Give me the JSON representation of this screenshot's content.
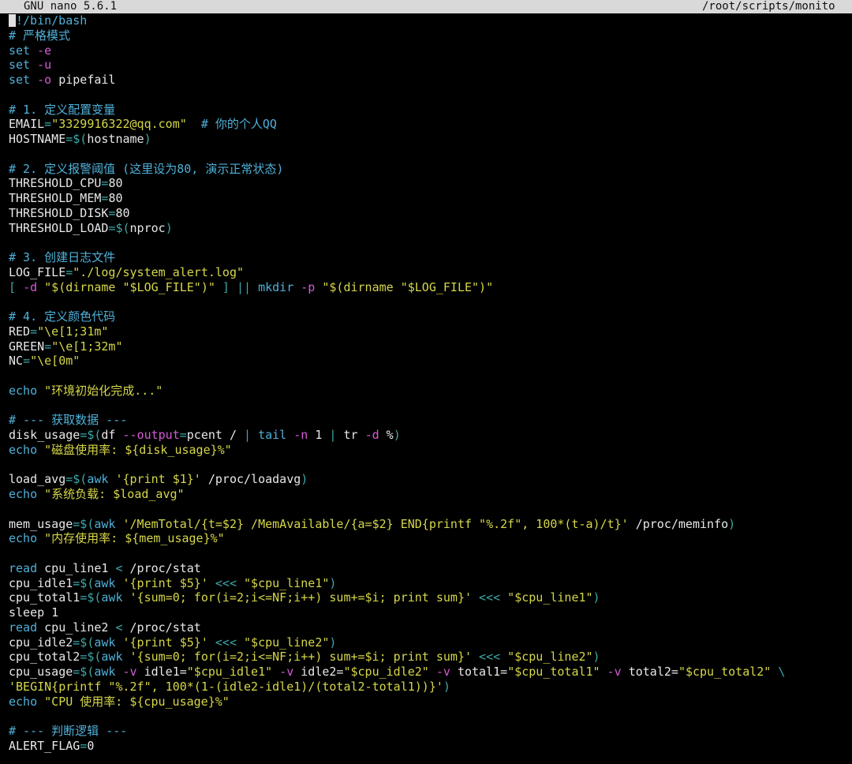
{
  "titlebar": {
    "app": "GNU nano 5.6.1",
    "path": "/root/scripts/monito"
  },
  "colors": {
    "background": "#000000",
    "default_text": "#e8e8e8",
    "comment": "#4fb0d8",
    "keyword": "#4fb0d8",
    "string": "#d6d64a",
    "operator": "#3fa8a8",
    "option": "#d65ad6",
    "titlebar_bg": "#d9d9d9"
  },
  "lines": [
    [
      {
        "t": "#!/bin/bash",
        "c": "comment",
        "cursor": true
      }
    ],
    [
      {
        "t": "# 严格模式",
        "c": "comment"
      }
    ],
    [
      {
        "t": "set",
        "c": "keyword"
      },
      {
        "t": " "
      },
      {
        "t": "-e",
        "c": "option"
      }
    ],
    [
      {
        "t": "set",
        "c": "keyword"
      },
      {
        "t": " "
      },
      {
        "t": "-u",
        "c": "option"
      }
    ],
    [
      {
        "t": "set",
        "c": "keyword"
      },
      {
        "t": " "
      },
      {
        "t": "-o",
        "c": "option"
      },
      {
        "t": " pipefail"
      }
    ],
    [],
    [
      {
        "t": "# 1. 定义配置变量",
        "c": "comment"
      }
    ],
    [
      {
        "t": "EMAIL"
      },
      {
        "t": "=",
        "c": "operator"
      },
      {
        "t": "\"3329916322@qq.com\"",
        "c": "string"
      },
      {
        "t": "  "
      },
      {
        "t": "# 你的个人QQ",
        "c": "comment"
      }
    ],
    [
      {
        "t": "HOSTNAME"
      },
      {
        "t": "=$(",
        "c": "operator"
      },
      {
        "t": "hostname"
      },
      {
        "t": ")",
        "c": "operator"
      }
    ],
    [],
    [
      {
        "t": "# 2. 定义报警阈值 (这里设为80, 演示正常状态)",
        "c": "comment"
      }
    ],
    [
      {
        "t": "THRESHOLD_CPU"
      },
      {
        "t": "=",
        "c": "operator"
      },
      {
        "t": "80"
      }
    ],
    [
      {
        "t": "THRESHOLD_MEM"
      },
      {
        "t": "=",
        "c": "operator"
      },
      {
        "t": "80"
      }
    ],
    [
      {
        "t": "THRESHOLD_DISK"
      },
      {
        "t": "=",
        "c": "operator"
      },
      {
        "t": "80"
      }
    ],
    [
      {
        "t": "THRESHOLD_LOAD"
      },
      {
        "t": "=$(",
        "c": "operator"
      },
      {
        "t": "nproc"
      },
      {
        "t": ")",
        "c": "operator"
      }
    ],
    [],
    [
      {
        "t": "# 3. 创建日志文件",
        "c": "comment"
      }
    ],
    [
      {
        "t": "LOG_FILE"
      },
      {
        "t": "=",
        "c": "operator"
      },
      {
        "t": "\"./log/system_alert.log\"",
        "c": "string"
      }
    ],
    [
      {
        "t": "[ ",
        "c": "operator"
      },
      {
        "t": "-d",
        "c": "option"
      },
      {
        "t": " "
      },
      {
        "t": "\"$(dirname \"$LOG_FILE\")\"",
        "c": "string"
      },
      {
        "t": " ] || ",
        "c": "operator"
      },
      {
        "t": "mkdir",
        "c": "keyword"
      },
      {
        "t": " "
      },
      {
        "t": "-p",
        "c": "option"
      },
      {
        "t": " "
      },
      {
        "t": "\"$(dirname \"$LOG_FILE\")\"",
        "c": "string"
      }
    ],
    [],
    [
      {
        "t": "# 4. 定义颜色代码",
        "c": "comment"
      }
    ],
    [
      {
        "t": "RED"
      },
      {
        "t": "=",
        "c": "operator"
      },
      {
        "t": "\"\\e[1;31m\"",
        "c": "string"
      }
    ],
    [
      {
        "t": "GREEN"
      },
      {
        "t": "=",
        "c": "operator"
      },
      {
        "t": "\"\\e[1;32m\"",
        "c": "string"
      }
    ],
    [
      {
        "t": "NC"
      },
      {
        "t": "=",
        "c": "operator"
      },
      {
        "t": "\"\\e[0m\"",
        "c": "string"
      }
    ],
    [],
    [
      {
        "t": "echo",
        "c": "keyword"
      },
      {
        "t": " "
      },
      {
        "t": "\"环境初始化完成...\"",
        "c": "string"
      }
    ],
    [],
    [
      {
        "t": "# --- 获取数据 ---",
        "c": "comment"
      }
    ],
    [
      {
        "t": "disk_usage"
      },
      {
        "t": "=$(",
        "c": "operator"
      },
      {
        "t": "df "
      },
      {
        "t": "--output",
        "c": "option"
      },
      {
        "t": "=",
        "c": "operator"
      },
      {
        "t": "pcent / "
      },
      {
        "t": "| ",
        "c": "operator"
      },
      {
        "t": "tail",
        "c": "keyword"
      },
      {
        "t": " "
      },
      {
        "t": "-n",
        "c": "option"
      },
      {
        "t": " 1 "
      },
      {
        "t": "| ",
        "c": "operator"
      },
      {
        "t": "tr "
      },
      {
        "t": "-d",
        "c": "option"
      },
      {
        "t": " %"
      },
      {
        "t": ")",
        "c": "operator"
      }
    ],
    [
      {
        "t": "echo",
        "c": "keyword"
      },
      {
        "t": " "
      },
      {
        "t": "\"磁盘使用率: ${disk_usage}%\"",
        "c": "string"
      }
    ],
    [],
    [
      {
        "t": "load_avg"
      },
      {
        "t": "=$(",
        "c": "operator"
      },
      {
        "t": "awk",
        "c": "keyword"
      },
      {
        "t": " "
      },
      {
        "t": "'{print $1}'",
        "c": "string"
      },
      {
        "t": " /proc/loadavg"
      },
      {
        "t": ")",
        "c": "operator"
      }
    ],
    [
      {
        "t": "echo",
        "c": "keyword"
      },
      {
        "t": " "
      },
      {
        "t": "\"系统负载: $load_avg\"",
        "c": "string"
      }
    ],
    [],
    [
      {
        "t": "mem_usage"
      },
      {
        "t": "=$(",
        "c": "operator"
      },
      {
        "t": "awk",
        "c": "keyword"
      },
      {
        "t": " "
      },
      {
        "t": "'/MemTotal/{t=$2} /MemAvailable/{a=$2} END{printf \"%.2f\", 100*(t-a)/t}'",
        "c": "string"
      },
      {
        "t": " /proc/meminfo"
      },
      {
        "t": ")",
        "c": "operator"
      }
    ],
    [
      {
        "t": "echo",
        "c": "keyword"
      },
      {
        "t": " "
      },
      {
        "t": "\"内存使用率: ${mem_usage}%\"",
        "c": "string"
      }
    ],
    [],
    [
      {
        "t": "read",
        "c": "keyword"
      },
      {
        "t": " cpu_line1 "
      },
      {
        "t": "<",
        "c": "operator"
      },
      {
        "t": " /proc/stat"
      }
    ],
    [
      {
        "t": "cpu_idle1"
      },
      {
        "t": "=$(",
        "c": "operator"
      },
      {
        "t": "awk",
        "c": "keyword"
      },
      {
        "t": " "
      },
      {
        "t": "'{print $5}'",
        "c": "string"
      },
      {
        "t": " "
      },
      {
        "t": "<<<",
        "c": "operator"
      },
      {
        "t": " "
      },
      {
        "t": "\"$cpu_line1\"",
        "c": "string"
      },
      {
        "t": ")",
        "c": "operator"
      }
    ],
    [
      {
        "t": "cpu_total1"
      },
      {
        "t": "=$(",
        "c": "operator"
      },
      {
        "t": "awk",
        "c": "keyword"
      },
      {
        "t": " "
      },
      {
        "t": "'{sum=0; for(i=2;i<=NF;i++) sum+=$i; print sum}'",
        "c": "string"
      },
      {
        "t": " "
      },
      {
        "t": "<<<",
        "c": "operator"
      },
      {
        "t": " "
      },
      {
        "t": "\"$cpu_line1\"",
        "c": "string"
      },
      {
        "t": ")",
        "c": "operator"
      }
    ],
    [
      {
        "t": "sleep 1"
      }
    ],
    [
      {
        "t": "read",
        "c": "keyword"
      },
      {
        "t": " cpu_line2 "
      },
      {
        "t": "<",
        "c": "operator"
      },
      {
        "t": " /proc/stat"
      }
    ],
    [
      {
        "t": "cpu_idle2"
      },
      {
        "t": "=$(",
        "c": "operator"
      },
      {
        "t": "awk",
        "c": "keyword"
      },
      {
        "t": " "
      },
      {
        "t": "'{print $5}'",
        "c": "string"
      },
      {
        "t": " "
      },
      {
        "t": "<<<",
        "c": "operator"
      },
      {
        "t": " "
      },
      {
        "t": "\"$cpu_line2\"",
        "c": "string"
      },
      {
        "t": ")",
        "c": "operator"
      }
    ],
    [
      {
        "t": "cpu_total2"
      },
      {
        "t": "=$(",
        "c": "operator"
      },
      {
        "t": "awk",
        "c": "keyword"
      },
      {
        "t": " "
      },
      {
        "t": "'{sum=0; for(i=2;i<=NF;i++) sum+=$i; print sum}'",
        "c": "string"
      },
      {
        "t": " "
      },
      {
        "t": "<<<",
        "c": "operator"
      },
      {
        "t": " "
      },
      {
        "t": "\"$cpu_line2\"",
        "c": "string"
      },
      {
        "t": ")",
        "c": "operator"
      }
    ],
    [
      {
        "t": "cpu_usage"
      },
      {
        "t": "=$(",
        "c": "operator"
      },
      {
        "t": "awk",
        "c": "keyword"
      },
      {
        "t": " "
      },
      {
        "t": "-v",
        "c": "option"
      },
      {
        "t": " idle1="
      },
      {
        "t": "\"$cpu_idle1\"",
        "c": "string"
      },
      {
        "t": " "
      },
      {
        "t": "-v",
        "c": "option"
      },
      {
        "t": " idle2="
      },
      {
        "t": "\"$cpu_idle2\"",
        "c": "string"
      },
      {
        "t": " "
      },
      {
        "t": "-v",
        "c": "option"
      },
      {
        "t": " total1="
      },
      {
        "t": "\"$cpu_total1\"",
        "c": "string"
      },
      {
        "t": " "
      },
      {
        "t": "-v",
        "c": "option"
      },
      {
        "t": " total2="
      },
      {
        "t": "\"$cpu_total2\"",
        "c": "string"
      },
      {
        "t": " \\",
        "c": "operator"
      }
    ],
    [
      {
        "t": "'BEGIN{printf \"%.2f\", 100*(1-(idle2-idle1)/(total2-total1))}'",
        "c": "string"
      },
      {
        "t": ")",
        "c": "operator"
      }
    ],
    [
      {
        "t": "echo",
        "c": "keyword"
      },
      {
        "t": " "
      },
      {
        "t": "\"CPU 使用率: ${cpu_usage}%\"",
        "c": "string"
      }
    ],
    [],
    [
      {
        "t": "# --- 判断逻辑 ---",
        "c": "comment"
      }
    ],
    [
      {
        "t": "ALERT_FLAG"
      },
      {
        "t": "=",
        "c": "operator"
      },
      {
        "t": "0"
      }
    ]
  ]
}
